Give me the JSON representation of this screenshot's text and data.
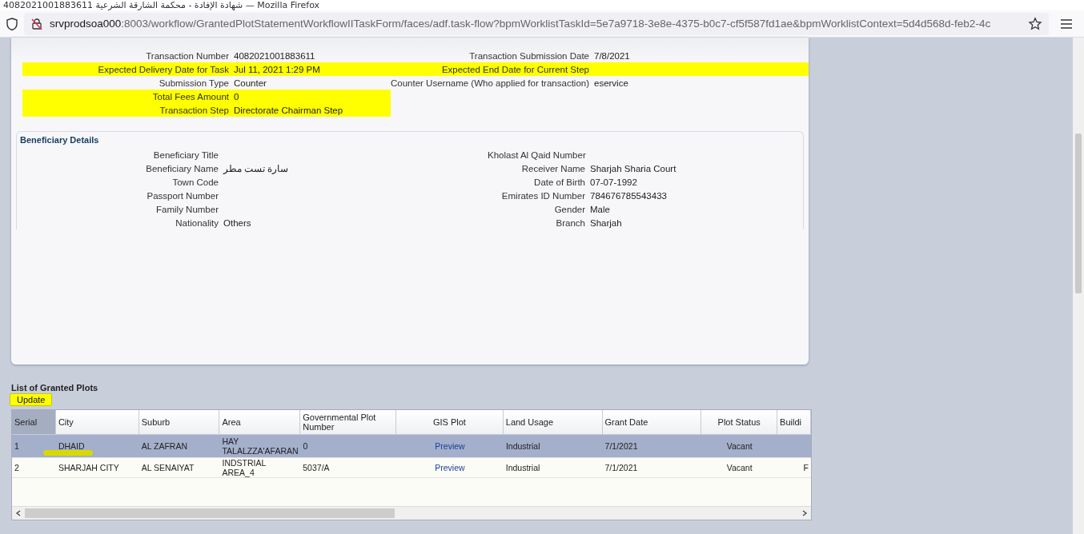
{
  "window": {
    "title": "4082021001883611 شهادة الإفادة - محكمة الشارقة الشرعية — Mozilla Firefox"
  },
  "address_bar": {
    "host": "srvprodsoa000",
    "path": ":8003/workflow/GrantedPlotStatementWorkflowIITaskForm/faces/adf.task-flow?bpmWorklistTaskId=5e7a9718-3e8e-4375-b0c7-cf5f587fd1ae&bpmWorklistContext=5d4d568d-feb2-4c"
  },
  "transaction": {
    "rows": [
      {
        "left": {
          "label": "Transaction Number",
          "value": "4082021001883611",
          "highlighted": false
        },
        "right": {
          "label": "Transaction Submission Date",
          "value": "7/8/2021",
          "highlighted": false
        }
      },
      {
        "left": {
          "label": "Expected Delivery Date for Task",
          "value": "Jul 11, 2021 1:29 PM",
          "highlighted": true
        },
        "right": {
          "label": "Expected End Date for Current Step",
          "highlighted": true
        }
      },
      {
        "left": {
          "label": "Submission Type",
          "value": "Counter",
          "highlighted": false
        },
        "right": {
          "label": "Counter Username (Who applied for transaction)",
          "value": "eservice",
          "highlighted": false
        }
      },
      {
        "left": {
          "label": "Total Fees Amount",
          "value": "0",
          "highlighted": true
        }
      },
      {
        "left": {
          "label": "Transaction Step",
          "value": "Directorate Chairman Step",
          "highlighted": true
        }
      }
    ]
  },
  "beneficiary": {
    "title": "Beneficiary Details",
    "rows": [
      {
        "left": {
          "label": "Beneficiary Title"
        },
        "right": {
          "label": "Kholast Al Qaid Number"
        }
      },
      {
        "left": {
          "label": "Beneficiary Name",
          "value": "سارة تست مطر"
        },
        "right": {
          "label": "Receiver Name",
          "value": "Sharjah Sharia Court"
        }
      },
      {
        "left": {
          "label": "Town Code"
        },
        "right": {
          "label": "Date of Birth",
          "value": "07-07-1992"
        }
      },
      {
        "left": {
          "label": "Passport Number"
        },
        "right": {
          "label": "Emirates ID Number",
          "value": "784676785543433"
        }
      },
      {
        "left": {
          "label": "Family Number"
        },
        "right": {
          "label": "Gender",
          "value": "Male"
        }
      },
      {
        "left": {
          "label": "Nationality",
          "value": "Others"
        },
        "right": {
          "label": "Branch",
          "value": "Sharjah"
        }
      }
    ]
  },
  "plots": {
    "title": "List of Granted Plots",
    "update_button": {
      "label": "Update",
      "highlighted": true
    },
    "columns": [
      "Serial",
      "City",
      "Suburb",
      "Area",
      "Governmental Plot Number",
      "GIS Plot",
      "Land Usage",
      "Grant Date",
      "Plot Status",
      "Buildi"
    ],
    "rows": [
      {
        "selected": true,
        "marked": true,
        "cells": [
          "1",
          "DHAID",
          "AL ZAFRAN",
          "HAY TALALZZA'AFARAN",
          "0",
          "Preview",
          "Industrial",
          "7/1/2021",
          "Vacant",
          ""
        ]
      },
      {
        "selected": false,
        "marked": false,
        "cells": [
          "2",
          "SHARJAH CITY",
          "AL SENAIYAT",
          "INDSTRIAL AREA_4",
          "5037/A",
          "Preview",
          "Industrial",
          "7/1/2021",
          "Vacant",
          "F"
        ]
      }
    ]
  }
}
